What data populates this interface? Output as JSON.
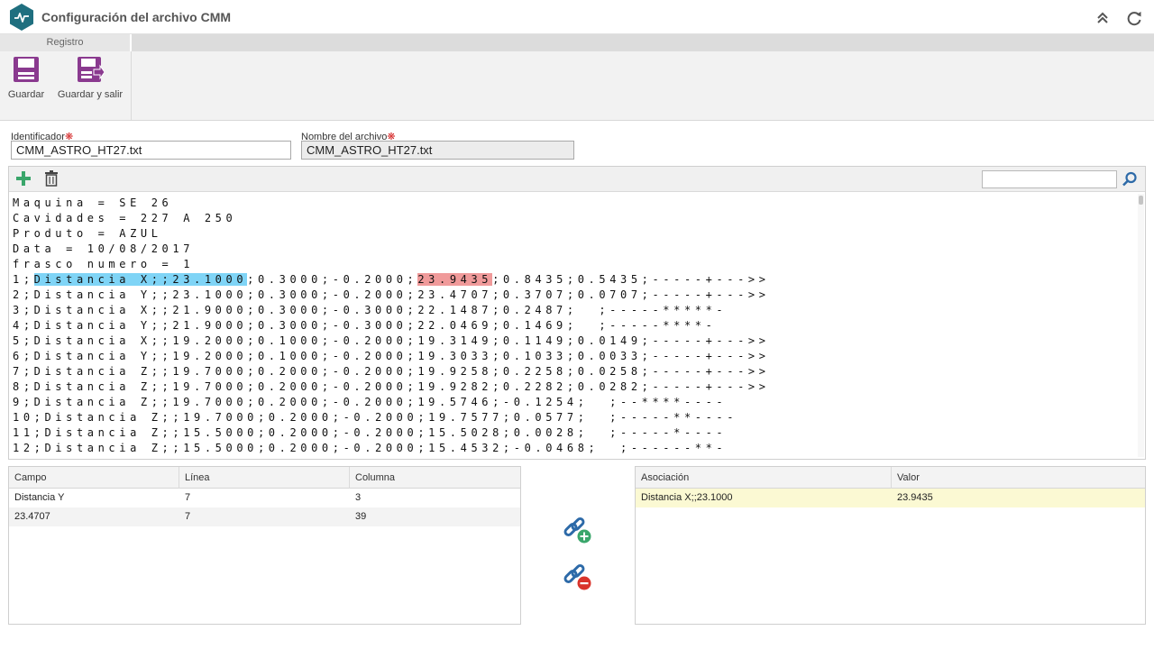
{
  "window": {
    "title": "Configuración del archivo CMM"
  },
  "ribbon": {
    "tab_label": "Registro",
    "save_label": "Guardar",
    "save_exit_label": "Guardar y salir"
  },
  "form": {
    "identifier_label": "Identificador",
    "identifier_value": "CMM_ASTRO_HT27.txt",
    "filename_label": "Nombre del archivo",
    "filename_value": "CMM_ASTRO_HT27.txt",
    "required_mark": "❋"
  },
  "editor": {
    "search_placeholder": "",
    "lines": [
      "Maquina = SE 26",
      "Cavidades = 227 A 250",
      "Produto = AZUL",
      "Data = 10/08/2017",
      "frasco numero = 1",
      "2;Distancia Y;;23.1000;0.3000;-0.2000;23.4707;0.3707;0.0707;-----+--->>",
      "3;Distancia X;;21.9000;0.3000;-0.3000;22.1487;0.2487;  ;-----*****-",
      "4;Distancia Y;;21.9000;0.3000;-0.3000;22.0469;0.1469;  ;-----****-",
      "5;Distancia X;;19.2000;0.1000;-0.2000;19.3149;0.1149;0.0149;-----+--->>",
      "6;Distancia Y;;19.2000;0.1000;-0.2000;19.3033;0.1033;0.0033;-----+--->>",
      "7;Distancia Z;;19.7000;0.2000;-0.2000;19.9258;0.2258;0.0258;-----+--->>",
      "8;Distancia Z;;19.7000;0.2000;-0.2000;19.9282;0.2282;0.0282;-----+--->>",
      "9;Distancia Z;;19.7000;0.2000;-0.2000;19.5746;-0.1254;  ;--****----",
      "10;Distancia Z;;19.7000;0.2000;-0.2000;19.7577;0.0577;  ;-----**----",
      "11;Distancia Z;;15.5000;0.2000;-0.2000;15.5028;0.0028;  ;-----*----",
      "12;Distancia Z;;15.5000;0.2000;-0.2000;15.4532;-0.0468;  ;------**-"
    ],
    "line6": {
      "prefix": "1;",
      "selected_blue": "Distancia X;;23.1000",
      "middle": ";0.3000;-0.2000;",
      "selected_red": "23.9435",
      "suffix": ";0.8435;0.5435;-----+--->>"
    }
  },
  "fields_grid": {
    "headers": [
      "Campo",
      "Línea",
      "Columna"
    ],
    "rows": [
      {
        "campo": "Distancia Y",
        "linea": "7",
        "columna": "3"
      },
      {
        "campo": "23.4707",
        "linea": "7",
        "columna": "39"
      }
    ]
  },
  "association_grid": {
    "headers": [
      "Asociación",
      "Valor"
    ],
    "rows": [
      {
        "asociacion": "Distancia X;;23.1000",
        "valor": "23.9435"
      }
    ]
  },
  "icons": {
    "app_logo": "pulse-icon",
    "collapse": "double-chevron-up-icon",
    "refresh": "refresh-icon",
    "save": "floppy-icon",
    "save_exit": "floppy-exit-icon",
    "add": "plus-icon",
    "delete": "trash-icon",
    "search": "search-icon",
    "link_add": "link-add-icon",
    "link_remove": "link-remove-icon"
  },
  "colors": {
    "brand": "#1f6f7f",
    "ribbon_icon": "#8a3a8f",
    "add_green": "#3aa66b",
    "link_blue": "#2d6aa8",
    "highlight_blue": "#7fd4f6",
    "highlight_red": "#f09a9a",
    "selected_row": "#fbf9d3"
  }
}
